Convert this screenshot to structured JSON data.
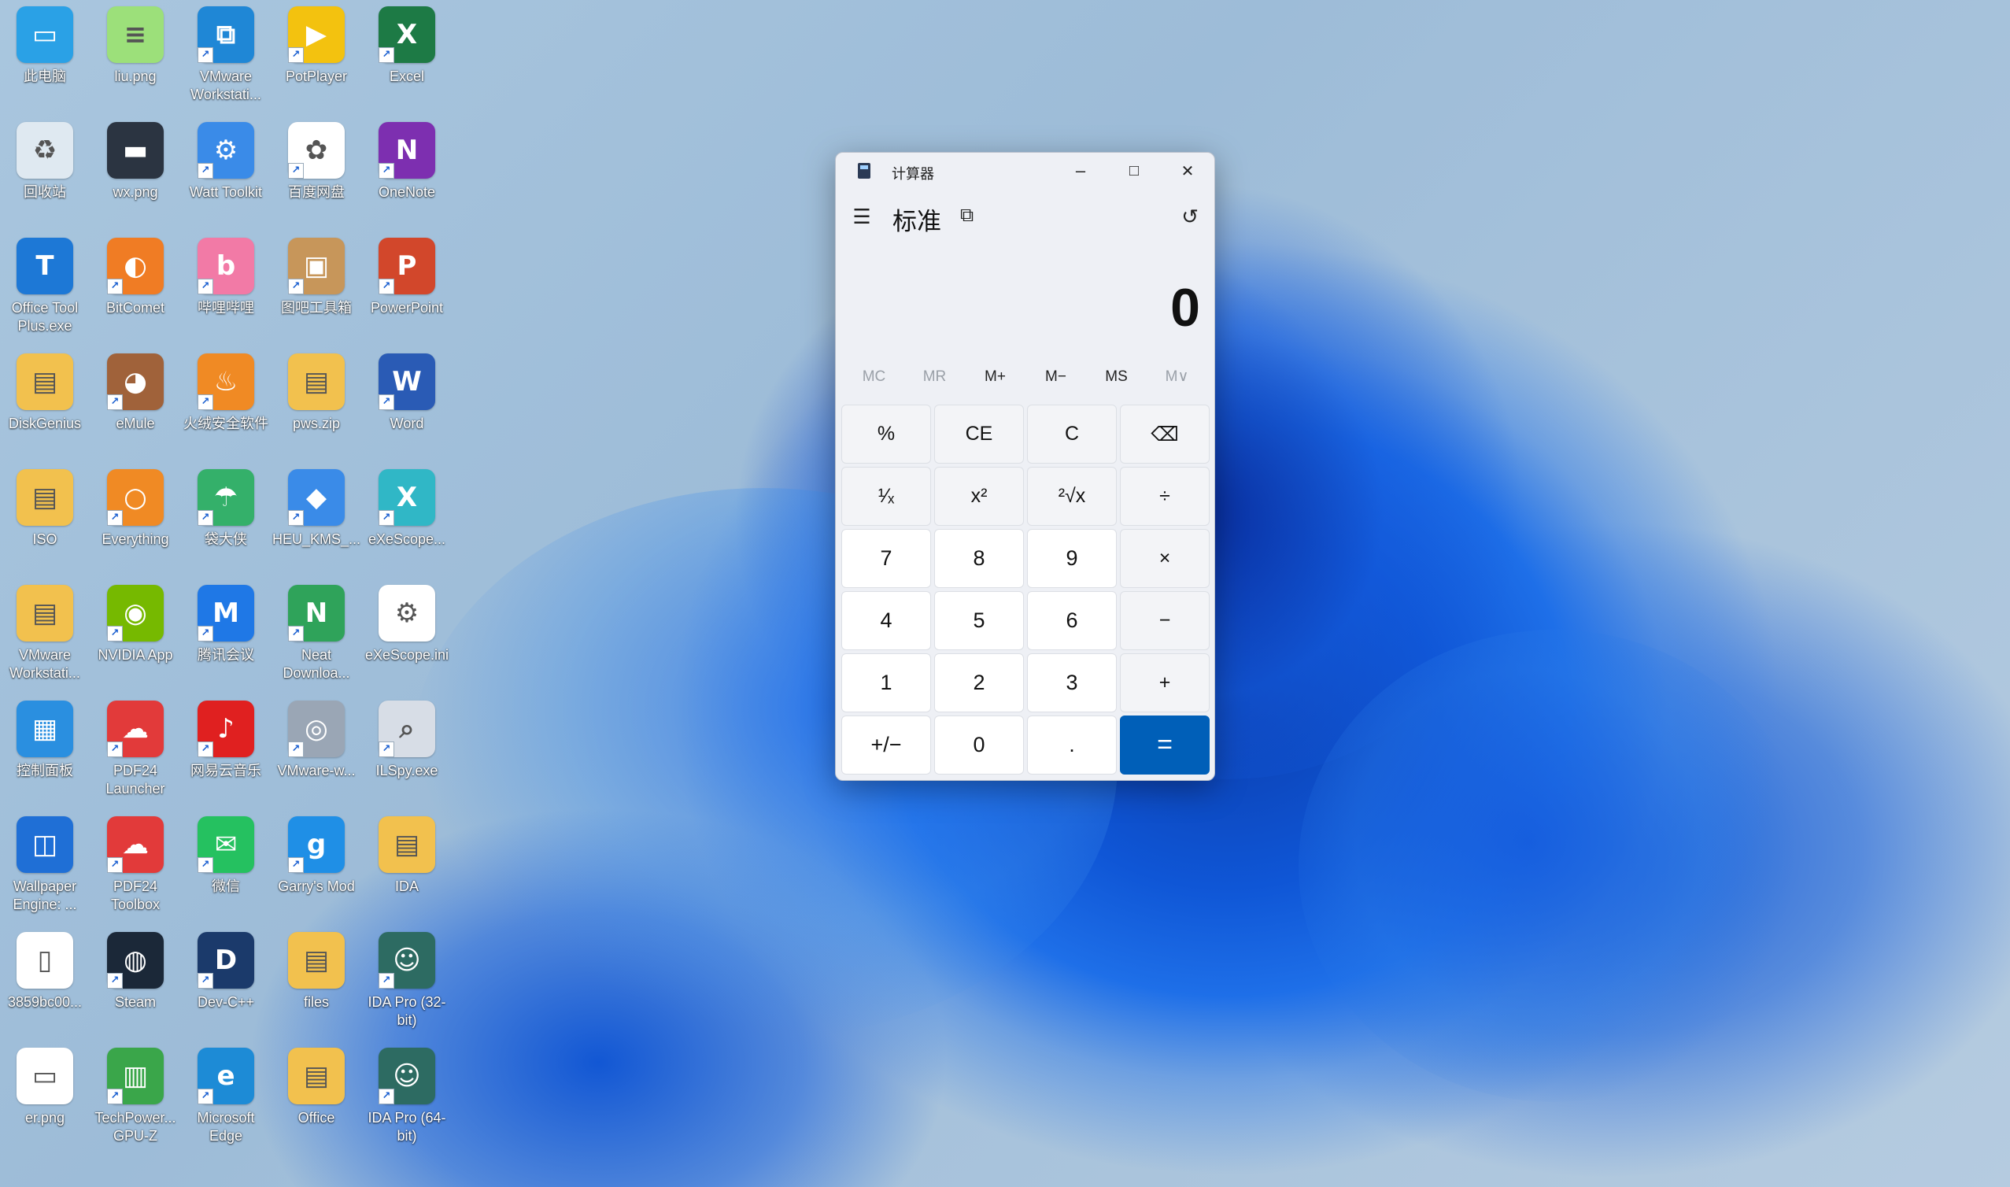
{
  "desktop": {
    "icons": [
      {
        "label": "此电脑",
        "color": "#2aa1e6",
        "glyph": "▭",
        "shortcut": false
      },
      {
        "label": "liu.png",
        "color": "#9ce07a",
        "glyph": "≡",
        "shortcut": false
      },
      {
        "label": "VMware Workstati...",
        "color": "#1f87d6",
        "glyph": "⧉",
        "shortcut": true
      },
      {
        "label": "PotPlayer",
        "color": "#f3c20f",
        "glyph": "▶",
        "shortcut": true
      },
      {
        "label": "Excel",
        "color": "#1d7a45",
        "glyph": "X",
        "shortcut": true
      },
      {
        "label": "回收站",
        "color": "#dfe9f1",
        "glyph": "♻",
        "shortcut": false
      },
      {
        "label": "wx.png",
        "color": "#2b3441",
        "glyph": "▬",
        "shortcut": false
      },
      {
        "label": "Watt Toolkit",
        "color": "#3a8be8",
        "glyph": "⚙",
        "shortcut": true
      },
      {
        "label": "百度网盘",
        "color": "#ffffff",
        "glyph": "✿",
        "shortcut": true
      },
      {
        "label": "OneNote",
        "color": "#7d2fb0",
        "glyph": "N",
        "shortcut": true
      },
      {
        "label": "Office Tool Plus.exe",
        "color": "#1d78d6",
        "glyph": "T",
        "shortcut": false
      },
      {
        "label": "BitComet",
        "color": "#f07c24",
        "glyph": "◐",
        "shortcut": true
      },
      {
        "label": "哔哩哔哩",
        "color": "#f27aa6",
        "glyph": "b",
        "shortcut": true
      },
      {
        "label": "图吧工具箱",
        "color": "#c7965a",
        "glyph": "▣",
        "shortcut": true
      },
      {
        "label": "PowerPoint",
        "color": "#d2472b",
        "glyph": "P",
        "shortcut": true
      },
      {
        "label": "DiskGenius",
        "color": "#f2c14e",
        "glyph": "▤",
        "shortcut": false
      },
      {
        "label": "eMule",
        "color": "#a0623a",
        "glyph": "◕",
        "shortcut": true
      },
      {
        "label": "火绒安全软件",
        "color": "#f08a24",
        "glyph": "♨",
        "shortcut": true
      },
      {
        "label": "pws.zip",
        "color": "#f2c14e",
        "glyph": "▤",
        "shortcut": false
      },
      {
        "label": "Word",
        "color": "#2a5bb5",
        "glyph": "W",
        "shortcut": true
      },
      {
        "label": "ISO",
        "color": "#f2c14e",
        "glyph": "▤",
        "shortcut": false
      },
      {
        "label": "Everything",
        "color": "#f08a24",
        "glyph": "○",
        "shortcut": true
      },
      {
        "label": "袋大侠",
        "color": "#34b06a",
        "glyph": "☂",
        "shortcut": true
      },
      {
        "label": "HEU_KMS_...",
        "color": "#3a8be8",
        "glyph": "◆",
        "shortcut": true
      },
      {
        "label": "eXeScope...",
        "color": "#30b7c6",
        "glyph": "X",
        "shortcut": true
      },
      {
        "label": "VMware Workstati...",
        "color": "#f2c14e",
        "glyph": "▤",
        "shortcut": false
      },
      {
        "label": "NVIDIA App",
        "color": "#76b900",
        "glyph": "◉",
        "shortcut": true
      },
      {
        "label": "腾讯会议",
        "color": "#1f78e6",
        "glyph": "M",
        "shortcut": true
      },
      {
        "label": "Neat Downloa...",
        "color": "#2fa35a",
        "glyph": "N",
        "shortcut": true
      },
      {
        "label": "eXeScope.ini",
        "color": "#ffffff",
        "glyph": "⚙",
        "shortcut": false
      },
      {
        "label": "控制面板",
        "color": "#2a8fe0",
        "glyph": "▦",
        "shortcut": false
      },
      {
        "label": "PDF24 Launcher",
        "color": "#e23a3a",
        "glyph": "☁",
        "shortcut": true
      },
      {
        "label": "网易云音乐",
        "color": "#e02020",
        "glyph": "♪",
        "shortcut": true
      },
      {
        "label": "VMware-w...",
        "color": "#9aa6b5",
        "glyph": "◎",
        "shortcut": true
      },
      {
        "label": "ILSpy.exe",
        "color": "#d7dde6",
        "glyph": "⌕",
        "shortcut": true
      },
      {
        "label": "Wallpaper Engine: ...",
        "color": "#1f6fd6",
        "glyph": "◫",
        "shortcut": false
      },
      {
        "label": "PDF24 Toolbox",
        "color": "#e23a3a",
        "glyph": "☁",
        "shortcut": true
      },
      {
        "label": "微信",
        "color": "#25c160",
        "glyph": "✉",
        "shortcut": true
      },
      {
        "label": "Garry's Mod",
        "color": "#1f8fe6",
        "glyph": "g",
        "shortcut": true
      },
      {
        "label": "IDA",
        "color": "#f2c14e",
        "glyph": "▤",
        "shortcut": false
      },
      {
        "label": "3859bc00...",
        "color": "#ffffff",
        "glyph": "▯",
        "shortcut": false
      },
      {
        "label": "Steam",
        "color": "#1b2838",
        "glyph": "◍",
        "shortcut": true
      },
      {
        "label": "Dev-C++",
        "color": "#1b3a6b",
        "glyph": "D",
        "shortcut": true
      },
      {
        "label": "files",
        "color": "#f2c14e",
        "glyph": "▤",
        "shortcut": false
      },
      {
        "label": "IDA Pro (32-bit)",
        "color": "#2d6b62",
        "glyph": "☺",
        "shortcut": true
      },
      {
        "label": "er.png",
        "color": "#ffffff",
        "glyph": "▭",
        "shortcut": false
      },
      {
        "label": "TechPower... GPU-Z",
        "color": "#3aa64a",
        "glyph": "▥",
        "shortcut": true
      },
      {
        "label": "Microsoft Edge",
        "color": "#1d8bd6",
        "glyph": "e",
        "shortcut": true
      },
      {
        "label": "Office",
        "color": "#f2c14e",
        "glyph": "▤",
        "shortcut": false
      },
      {
        "label": "IDA Pro (64-bit)",
        "color": "#2d6b62",
        "glyph": "☺",
        "shortcut": true
      }
    ]
  },
  "calculator": {
    "title": "计算器",
    "minimize": "–",
    "maximize": "□",
    "close": "✕",
    "hamburger": "☰",
    "mode": "标准",
    "keep_on_top": "⧉",
    "history": "↺",
    "display": "0",
    "memory": [
      {
        "label": "MC",
        "enabled": false
      },
      {
        "label": "MR",
        "enabled": false
      },
      {
        "label": "M+",
        "enabled": true
      },
      {
        "label": "M−",
        "enabled": true
      },
      {
        "label": "MS",
        "enabled": true
      },
      {
        "label": "M∨",
        "enabled": false
      }
    ],
    "keys": [
      {
        "label": "%",
        "kind": "op",
        "name": "percent-button"
      },
      {
        "label": "CE",
        "kind": "op",
        "name": "clear-entry-button"
      },
      {
        "label": "C",
        "kind": "op",
        "name": "clear-button"
      },
      {
        "label": "⌫",
        "kind": "op",
        "name": "backspace-button"
      },
      {
        "label": "¹⁄ₓ",
        "kind": "op",
        "name": "reciprocal-button"
      },
      {
        "label": "x²",
        "kind": "op",
        "name": "square-button"
      },
      {
        "label": "²√x",
        "kind": "op",
        "name": "square-root-button"
      },
      {
        "label": "÷",
        "kind": "op",
        "name": "divide-button"
      },
      {
        "label": "7",
        "kind": "num",
        "name": "digit-7-button"
      },
      {
        "label": "8",
        "kind": "num",
        "name": "digit-8-button"
      },
      {
        "label": "9",
        "kind": "num",
        "name": "digit-9-button"
      },
      {
        "label": "×",
        "kind": "op",
        "name": "multiply-button"
      },
      {
        "label": "4",
        "kind": "num",
        "name": "digit-4-button"
      },
      {
        "label": "5",
        "kind": "num",
        "name": "digit-5-button"
      },
      {
        "label": "6",
        "kind": "num",
        "name": "digit-6-button"
      },
      {
        "label": "−",
        "kind": "op",
        "name": "subtract-button"
      },
      {
        "label": "1",
        "kind": "num",
        "name": "digit-1-button"
      },
      {
        "label": "2",
        "kind": "num",
        "name": "digit-2-button"
      },
      {
        "label": "3",
        "kind": "num",
        "name": "digit-3-button"
      },
      {
        "label": "+",
        "kind": "op",
        "name": "add-button"
      },
      {
        "label": "+/−",
        "kind": "num",
        "name": "negate-button"
      },
      {
        "label": "0",
        "kind": "num",
        "name": "digit-0-button"
      },
      {
        "label": ".",
        "kind": "num",
        "name": "decimal-button"
      },
      {
        "label": "=",
        "kind": "equals",
        "name": "equals-button"
      }
    ]
  }
}
